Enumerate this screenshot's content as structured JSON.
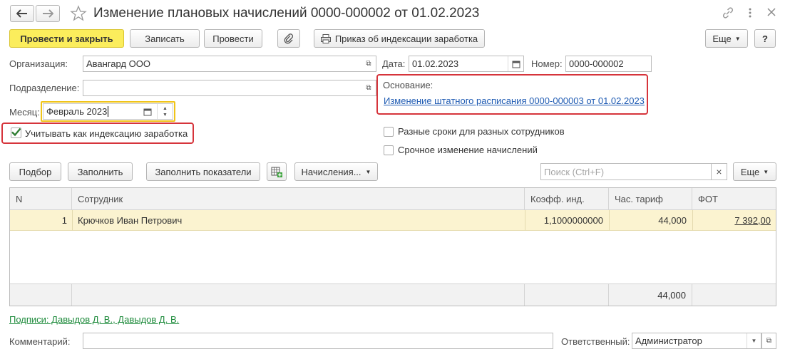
{
  "window": {
    "title": "Изменение плановых начислений 0000-000002 от 01.02.2023",
    "nav_back_icon": "arrow-left",
    "nav_forward_icon": "arrow-right",
    "favorite_icon": "star-outline",
    "link_icon": "chain-link",
    "more_icon": "vertical-dots",
    "close_icon": "x"
  },
  "toolbar": {
    "post_close_label": "Провести и закрыть",
    "save_label": "Записать",
    "post_label": "Провести",
    "attach_icon": "paperclip",
    "print_label": "Приказ об индексации заработка",
    "print_icon": "printer",
    "more_label": "Еще",
    "help_label": "?"
  },
  "form": {
    "org_label": "Организация:",
    "org_value": "Авангард ООО",
    "date_label": "Дата:",
    "date_value": "01.02.2023",
    "number_label": "Номер:",
    "number_value": "0000-000002",
    "dept_label": "Подразделение:",
    "dept_value": "",
    "month_label": "Месяц:",
    "month_value": "Февраль 2023",
    "basis_label": "Основание:",
    "basis_link": "Изменение штатного расписания 0000-000003 от 01.02.2023",
    "indexation_label": "Учитывать как индексацию заработка",
    "indexation_checked": true,
    "diff_terms_label": "Разные сроки для разных сотрудников",
    "urgent_label": "Срочное изменение начислений"
  },
  "table_toolbar": {
    "select_label": "Подбор",
    "fill_label": "Заполнить",
    "fill_indicators_label": "Заполнить показатели",
    "grid_icon": "add-table",
    "accruals_label": "Начисления...",
    "search_placeholder": "Поиск (Ctrl+F)",
    "clear_label": "×",
    "more_label": "Еще"
  },
  "table": {
    "columns": [
      "N",
      "Сотрудник",
      "Коэфф. инд.",
      "Час. тариф",
      "ФОТ"
    ],
    "rows": [
      {
        "n": "1",
        "employee": "Крючков Иван Петрович",
        "coef": "1,1000000000",
        "rate": "44,000",
        "fot": "7 392,00"
      }
    ],
    "footer_rate_total": "44,000"
  },
  "bottom": {
    "signatures_link": "Подписи: Давыдов Д. В., Давыдов Д. В.",
    "comment_label": "Комментарий:",
    "comment_value": "",
    "responsible_label": "Ответственный:",
    "responsible_value": "Администратор"
  },
  "colors": {
    "primary_button": "#fbed5c",
    "highlight_row": "#fbf3d0",
    "red_frame": "#d6343b",
    "link_blue": "#1f5bb3",
    "link_green": "#1c8a3a",
    "month_focus": "#f0c419"
  }
}
